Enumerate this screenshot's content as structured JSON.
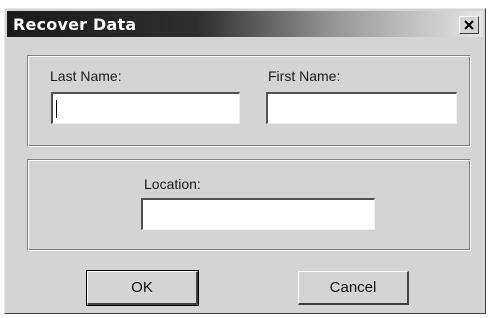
{
  "dialog": {
    "title": "Recover Data",
    "close_icon": "close-icon"
  },
  "name_group": {
    "last_name_label": "Last Name:",
    "last_name_value": "",
    "first_name_label": "First Name:",
    "first_name_value": ""
  },
  "location_group": {
    "location_label": "Location:",
    "location_value": ""
  },
  "buttons": {
    "ok_label": "OK",
    "cancel_label": "Cancel"
  }
}
